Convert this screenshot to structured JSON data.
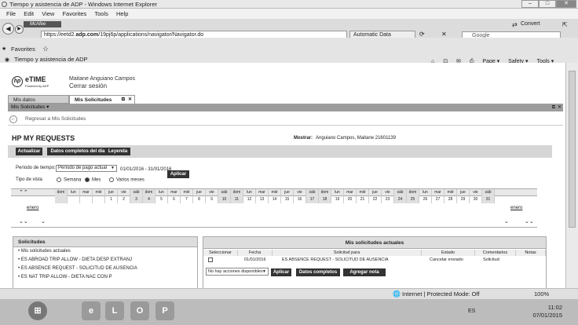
{
  "window": {
    "title": "Tiempo y asistencia de ADP - Windows Internet Explorer"
  },
  "menu": [
    "File",
    "Edit",
    "View",
    "Favorites",
    "Tools",
    "Help"
  ],
  "toolbar": {
    "mcafee": "McAfee",
    "url_prefix": "https://eetd2.",
    "url_host": "adp.com",
    "url_rest": "/19pj6p/applications/navigator/Navigator.do",
    "cert_tab": "Automatic Data Processi...",
    "convert": "Convert",
    "search_placeholder": "Google"
  },
  "favorites": {
    "label": "Favorites",
    "tab_title": "Tiempo y asistencia de ADP"
  },
  "commands": [
    "Page ▾",
    "Safety ▾",
    "Tools ▾"
  ],
  "app": {
    "brand": "eTIME",
    "brand_sub": "Powered by ADP",
    "user_name": "Maitane Anguiano Campos",
    "logout": "Cerrar sesión",
    "tabs": [
      "Mis datos",
      "Mis Solicitudes"
    ],
    "section": "Mis Solicitudes",
    "back_link": "Regresar a Mis Solicitudes",
    "heading": "HP MY REQUESTS",
    "show_label": "Mostrar:",
    "show_value": "Anguiano Campos, Maitane   21601139",
    "buttons": {
      "update": "Actualizar",
      "full_data": "Datos completos del día",
      "legend": "Leyenda"
    },
    "period_label": "Período de tiempo:",
    "period_value": "Período de pago actual",
    "date_range": "01/01/2016 - 31/01/2016",
    "apply": "Aplicar",
    "view_type_label": "Tipo de vista",
    "view_types": [
      "Semana",
      "Mes",
      "Varios meses"
    ],
    "calendar": {
      "days": [
        "dom",
        "lun",
        "mar",
        "mié",
        "jue",
        "vie",
        "sáb",
        "dom",
        "lun",
        "mar",
        "mié",
        "jue",
        "vie",
        "sáb",
        "dom",
        "lun",
        "mar",
        "mié",
        "jue",
        "vie",
        "sáb",
        "dom",
        "lun",
        "mar",
        "mié",
        "jue",
        "vie",
        "sáb",
        "dom",
        "lun",
        "mar",
        "mié",
        "jue",
        "vie",
        "sáb"
      ],
      "dates": [
        "",
        "",
        "",
        "",
        "1",
        "2",
        "3",
        "4",
        "5",
        "6",
        "7",
        "8",
        "9",
        "10",
        "11",
        "12",
        "13",
        "14",
        "15",
        "16",
        "17",
        "18",
        "19",
        "20",
        "21",
        "22",
        "23",
        "24",
        "25",
        "26",
        "27",
        "28",
        "29",
        "30",
        "31"
      ],
      "month_left": "enero",
      "month_right": "enero"
    },
    "left_panel": {
      "title": "Solicitudes",
      "items": [
        "Mis solicitudes actuales",
        "ES ABROAD TRIP ALLOW - DIETA DESP EXTRANJ",
        "ES ABSENCE REQUEST - SOLICITUD DE AUSENCIA",
        "ES NAT TRIP ALLOW - DIETA NAC CON P"
      ]
    },
    "right_panel": {
      "title": "Mis solicitudes actuales",
      "columns": [
        "Seleccionar",
        "Fecha",
        "Solicitud para",
        "Estado",
        "Comentarios",
        "Notas"
      ],
      "row": {
        "fecha": "01/01/2016",
        "solicitud": "ES ABSENCE REQUEST - SOLICITUD DE AUSENCIA",
        "estado": "Cancelar enviado",
        "comentarios": "Solicitud"
      },
      "actions_placeholder": "No hay acciones disponibles",
      "apply": "Aplicar",
      "full_data": "Datos completos",
      "add_note": "Agregar nota"
    }
  },
  "status": {
    "zone": "Internet | Protected Mode: Off",
    "zoom": "100%"
  },
  "taskbar": {
    "lang": "ES",
    "time": "11:02",
    "date": "07/01/2015"
  }
}
